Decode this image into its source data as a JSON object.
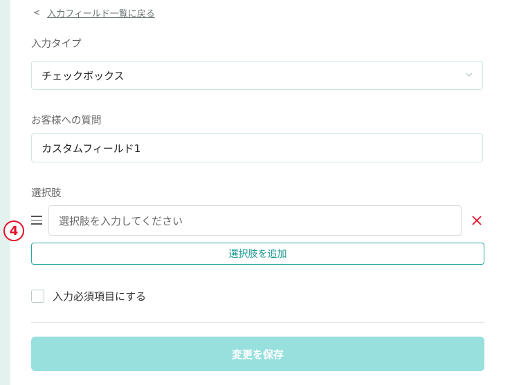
{
  "back_link": {
    "label": "入力フィールド一覧に戻る"
  },
  "input_type": {
    "label": "入力タイプ",
    "selected": "チェックボックス"
  },
  "question": {
    "label": "お客様への質問",
    "value": "カスタムフィールド1"
  },
  "choices": {
    "label": "選択肢",
    "items": [
      {
        "placeholder": "選択肢を入力してください",
        "value": ""
      }
    ],
    "add_label": "選択肢を追加"
  },
  "step_badge": "4",
  "required": {
    "label": "入力必須項目にする",
    "checked": false
  },
  "save_label": "変更を保存",
  "colors": {
    "accent": "#27a9a1",
    "save_disabled": "#97e0de",
    "delete": "#e3102a",
    "background": "#e3f2ee"
  },
  "icons": {
    "back": "chevron-left-icon",
    "select": "chevron-down-icon",
    "handle": "drag-handle-icon",
    "delete": "close-icon"
  }
}
